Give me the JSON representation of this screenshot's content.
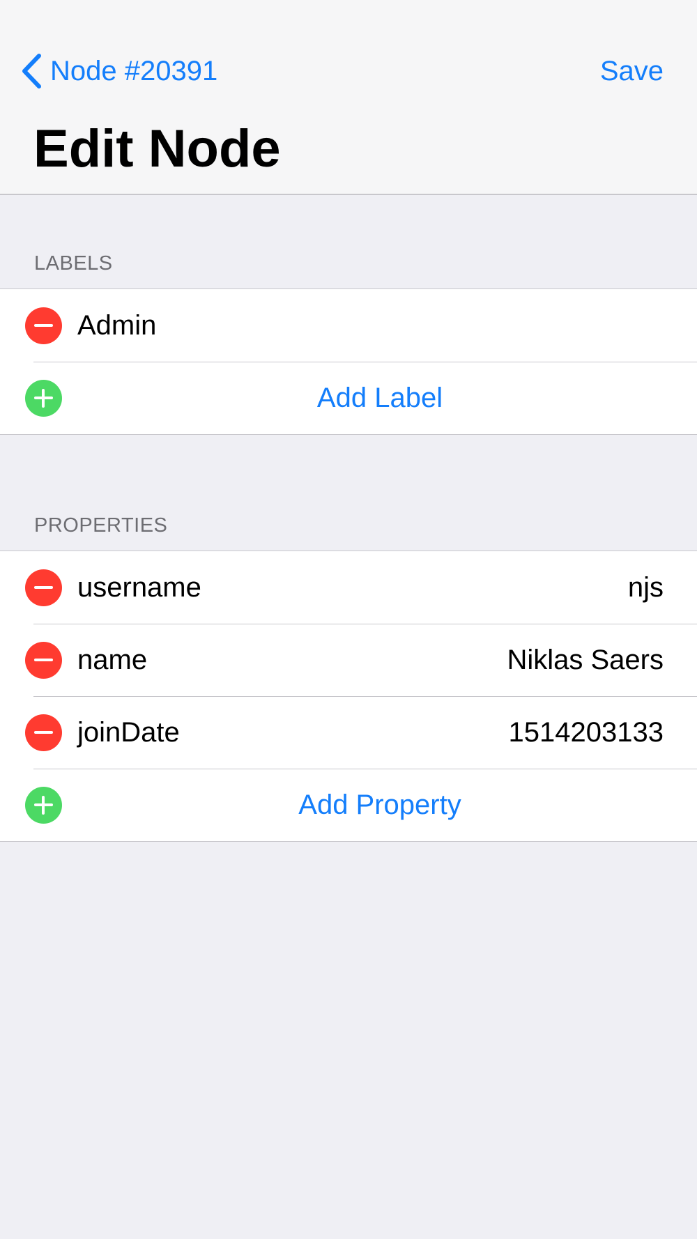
{
  "navbar": {
    "back_label": "Node #20391",
    "save_label": "Save",
    "title": "Edit Node"
  },
  "labels_section": {
    "header": "LABELS",
    "items": [
      {
        "label": "Admin"
      }
    ],
    "add_label": "Add Label"
  },
  "properties_section": {
    "header": "PROPERTIES",
    "items": [
      {
        "key": "username",
        "value": "njs"
      },
      {
        "key": "name",
        "value": "Niklas Saers"
      },
      {
        "key": "joinDate",
        "value": "1514203133"
      }
    ],
    "add_label": "Add Property"
  },
  "colors": {
    "accent": "#147efb",
    "remove": "#ff3b30",
    "add": "#4cd964",
    "background": "#efeff4"
  },
  "icons": {
    "back": "chevron-left-icon",
    "remove": "minus-circle-icon",
    "add": "plus-circle-icon"
  }
}
